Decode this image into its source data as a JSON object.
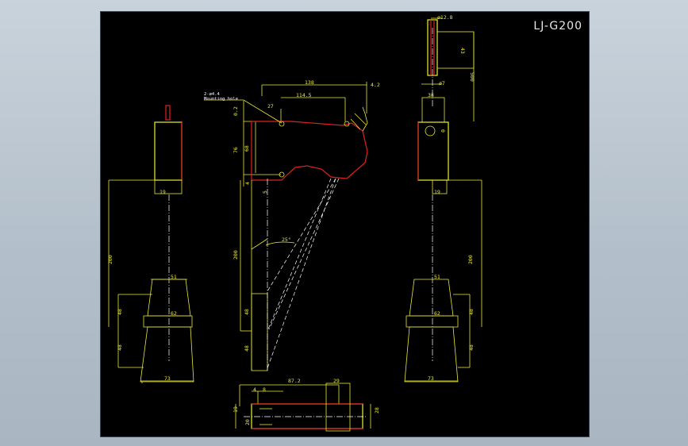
{
  "title": "LJ-G200",
  "callout": {
    "line1": "2-ø4.4",
    "line2": "Mounting hole"
  },
  "dims": {
    "d138": "138",
    "d4_2": "4.2",
    "d114_5": "114.5",
    "d27": "27",
    "d0_2": "0.2",
    "d76": "76",
    "d68": "68",
    "d4": "4",
    "d5": "5",
    "d200_side": "200",
    "d48_side_a": "48",
    "d48_side_b": "48",
    "angle": "25°",
    "d19_left": "19",
    "d200_left": "200",
    "d51_left": "51",
    "d62_left": "62",
    "d48_left_a": "48",
    "d48_left_b": "48",
    "d73_left": "73",
    "d12_8": "ø12.8",
    "d43": "43",
    "d500": "500",
    "d7": "ø7",
    "d38": "38",
    "d0": "0",
    "d19_right": "19",
    "d200_right": "200",
    "d51_right": "51",
    "d62_right": "62",
    "d48_right_a": "48",
    "d48_right_b": "48",
    "d73_right": "73",
    "d87_2": "87.2",
    "d29": "29",
    "d4_bottom": "4",
    "d8": "8",
    "d19_bottom": "19",
    "d20": "20",
    "d28": "28"
  },
  "colors": {
    "dim": "#e8e83a",
    "outline": "#e02020",
    "body": "#f0f030",
    "center": "#ffffff",
    "background": "#000000"
  }
}
